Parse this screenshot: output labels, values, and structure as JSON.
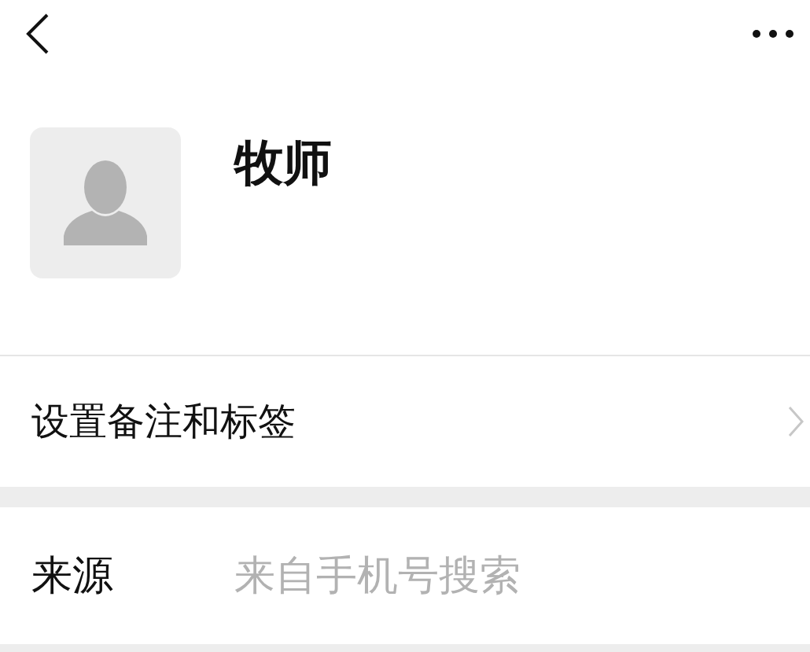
{
  "profile": {
    "name": "牧师"
  },
  "menu_items": [
    {
      "label": "设置备注和标签"
    }
  ],
  "info_rows": [
    {
      "label": "来源",
      "value": "来自手机号搜索"
    }
  ]
}
